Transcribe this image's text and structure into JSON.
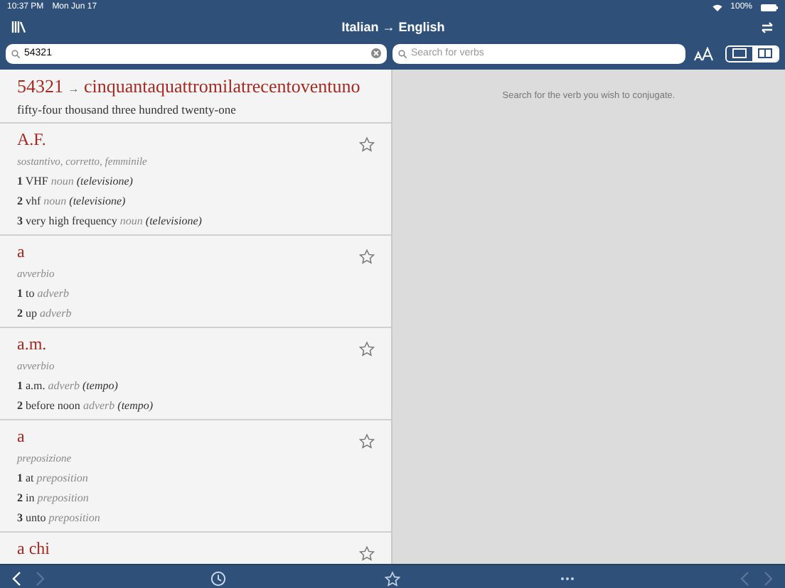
{
  "status_bar": {
    "time": "10:37 PM",
    "date": "Mon Jun 17",
    "battery": "100%"
  },
  "nav": {
    "title": "Italian → English"
  },
  "search": {
    "value": "54321"
  },
  "verb_search": {
    "placeholder": "Search for verbs"
  },
  "view_modes": [
    {
      "kind": "single",
      "selected": false
    },
    {
      "kind": "split",
      "selected": true
    }
  ],
  "number_result": {
    "number": "54321",
    "arrow": "→",
    "words": "cinquantaquattromilatrecentoventuno",
    "translation": "fifty-four thousand three hundred twenty-one"
  },
  "entries": [
    {
      "headword": "A.F.",
      "pos": "sostantivo, corretto, femminile",
      "starred": false,
      "senses": [
        {
          "number": "1",
          "text": "VHF",
          "pos": "noun",
          "note": "(televisione)"
        },
        {
          "number": "2",
          "text": "vhf",
          "pos": "noun",
          "note": "(televisione)"
        },
        {
          "number": "3",
          "text": "very high frequency",
          "pos": "noun",
          "note": "(televisione)"
        }
      ]
    },
    {
      "headword": "a",
      "pos": "avverbio",
      "starred": false,
      "senses": [
        {
          "number": "1",
          "text": "to",
          "pos": "adverb"
        },
        {
          "number": "2",
          "text": "up",
          "pos": "adverb"
        }
      ]
    },
    {
      "headword": "a.m.",
      "pos": "avverbio",
      "starred": false,
      "senses": [
        {
          "number": "1",
          "text": "a.m.",
          "pos": "adverb",
          "note": "(tempo)"
        },
        {
          "number": "2",
          "text": "before noon",
          "pos": "adverb",
          "note": "(tempo)"
        }
      ]
    },
    {
      "headword": "a",
      "pos": "preposizione",
      "starred": false,
      "senses": [
        {
          "number": "1",
          "text": "at",
          "pos": "preposition"
        },
        {
          "number": "2",
          "text": "in",
          "pos": "preposition"
        },
        {
          "number": "3",
          "text": "unto",
          "pos": "preposition"
        }
      ]
    },
    {
      "headword": "a chi",
      "starred": false
    }
  ],
  "conjugation_hint": "Search for the verb you wish to conjugate.",
  "toolbar": [
    {
      "kind": "back",
      "disabled": false
    },
    {
      "kind": "forward",
      "disabled": true
    },
    {
      "kind": "history",
      "disabled": false
    },
    {
      "kind": "favorites",
      "disabled": false
    },
    {
      "kind": "more",
      "disabled": false
    },
    {
      "kind": "back",
      "disabled": true
    },
    {
      "kind": "forward",
      "disabled": true
    }
  ]
}
